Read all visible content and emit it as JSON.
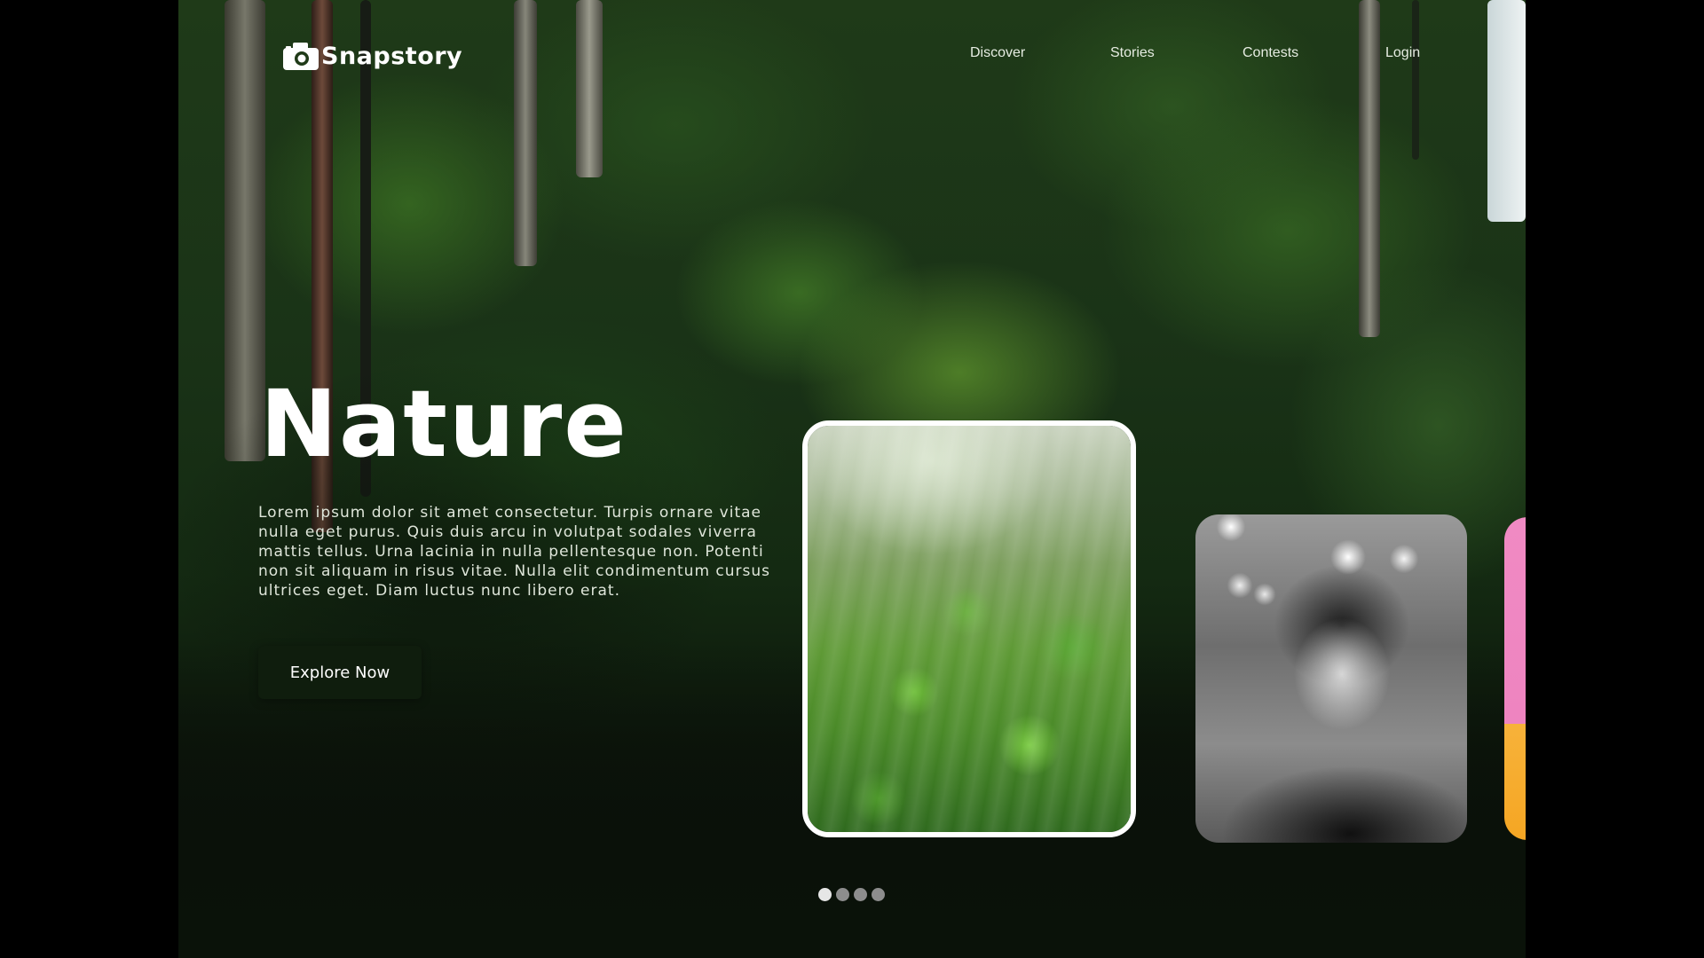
{
  "header": {
    "brand_name": "Snapstory",
    "brand_icon": "camera-icon",
    "nav": [
      {
        "label": "Discover"
      },
      {
        "label": "Stories"
      },
      {
        "label": "Contests"
      },
      {
        "label": "Login"
      }
    ]
  },
  "hero": {
    "title": "Nature",
    "description": "Lorem ipsum dolor sit amet consectetur. Turpis ornare vitae nulla eget purus. Quis duis arcu in volutpat sodales viverra mattis tellus. Urna lacinia in nulla pellentesque non. Potenti non sit aliquam in risus vitae. Nulla elit condimentum cursus ultrices eget. Diam luctus nunc libero erat.",
    "cta_label": "Explore Now"
  },
  "carousel": {
    "cards": [
      {
        "subject": "forest canopy",
        "active": true
      },
      {
        "subject": "portrait",
        "active": false
      },
      {
        "subject": "colorful",
        "active": false
      }
    ],
    "dots": 4,
    "active_dot": 1
  },
  "colors": {
    "page_bg": "#000000",
    "button_bg": "#0f1d0d",
    "text": "#ffffff",
    "dot_active": "#e6e6e6",
    "dot_inactive": "#8d8d8d"
  }
}
